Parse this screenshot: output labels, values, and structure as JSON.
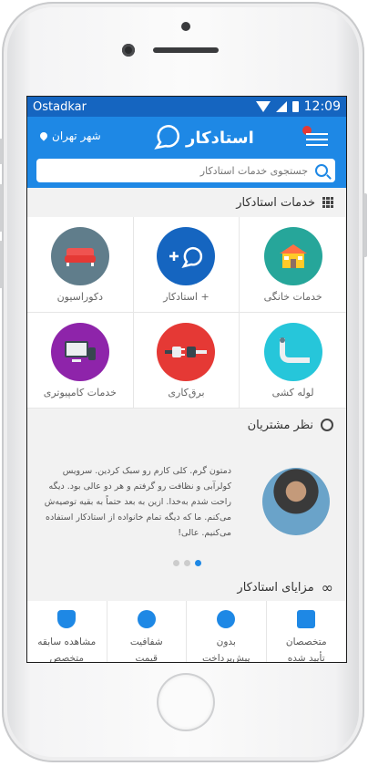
{
  "status_bar": {
    "carrier": "Ostadkar",
    "time": "12:09"
  },
  "app_bar": {
    "city": "شهر تهران",
    "logo_text": "استادکار",
    "search": {
      "placeholder": "جستجوی خدمات استادکار",
      "value": ""
    }
  },
  "services": {
    "title": "خدمات استادکار",
    "items": [
      {
        "label": "دکوراسیون",
        "icon": "sofa-icon",
        "color": "#607d8b"
      },
      {
        "label": "استادکار +",
        "icon": "plus-logo-icon",
        "color": "#1565c0"
      },
      {
        "label": "خدمات خانگی",
        "icon": "house-icon",
        "color": "#26a69a"
      },
      {
        "label": "خدمات کامپیوتری",
        "icon": "computer-icon",
        "color": "#8e24aa"
      },
      {
        "label": "برق‌کاری",
        "icon": "plug-icon",
        "color": "#e53935"
      },
      {
        "label": "لوله کشی",
        "icon": "pipe-icon",
        "color": "#26c6da"
      }
    ]
  },
  "reviews": {
    "title": "نظر مشتریان",
    "text": "دمتون گرم. کلی کارم رو سبک کردین. سرویس کولرآبی و نظافت رو گرفتم و هر دو عالی بود. دیگه راحت شدم بەخدا. ازین به بعد حتماً به بقیه توصیه‌ش می‌کنم. ما که دیگه تمام خانواده از استادکار استفاده می‌کنیم. عالی!",
    "dots": 3,
    "active_dot": 3
  },
  "advantages": {
    "title": "مزایای استادکار",
    "items": [
      {
        "label_line1": "مشاهده سابقه",
        "label_line2": "متخصص",
        "icon": "shield-check-icon"
      },
      {
        "label_line1": "شفافیت",
        "label_line2": "قیمت",
        "icon": "star-badge-icon"
      },
      {
        "label_line1": "بدون",
        "label_line2": "پیش‌پرداخت",
        "icon": "star-badge-icon"
      },
      {
        "label_line1": "متخصصان",
        "label_line2": "تأیید شده",
        "icon": "id-badge-icon"
      }
    ]
  }
}
